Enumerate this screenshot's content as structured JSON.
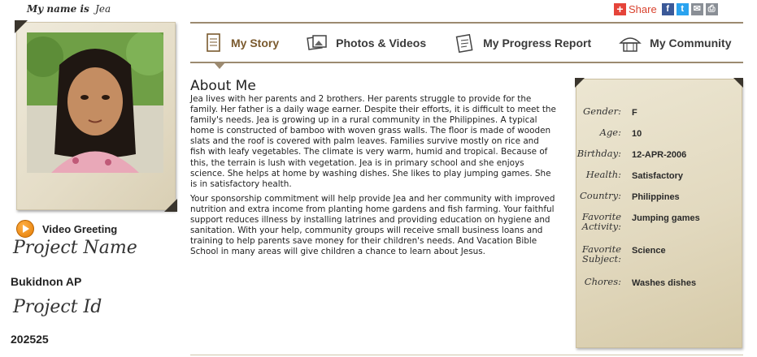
{
  "header": {
    "name_label": "My name is",
    "child_name": "Jea"
  },
  "share": {
    "label": "Share",
    "plus": "+",
    "icons": [
      "facebook-icon",
      "twitter-icon",
      "email-icon",
      "print-icon"
    ]
  },
  "nav": {
    "tabs": [
      {
        "label": "My Story",
        "icon": "book-icon",
        "active": true
      },
      {
        "label": "Photos & Videos",
        "icon": "photos-icon",
        "active": false
      },
      {
        "label": "My Progress Report",
        "icon": "report-icon",
        "active": false
      },
      {
        "label": "My Community",
        "icon": "hut-icon",
        "active": false
      }
    ]
  },
  "video": {
    "label": "Video Greeting"
  },
  "project": {
    "name_label": "Project Name",
    "name_value": "Bukidnon AP",
    "id_label": "Project Id",
    "id_value": "202525"
  },
  "about": {
    "title": "About Me",
    "paragraphs": [
      "Jea lives with her parents and 2 brothers. Her parents struggle to provide for the family. Her father is a daily wage earner. Despite their efforts, it is difficult to meet the family's needs. Jea is growing up in a rural community in the Philippines. A typical home is constructed of bamboo with woven grass walls. The floor is made of wooden slats and the roof is covered with palm leaves. Families survive mostly on rice and fish with leafy vegetables. The climate is very warm, humid and tropical. Because of this, the terrain is lush with vegetation. Jea is in primary school and she enjoys science. She helps at home by washing dishes. She likes to play jumping games. She is in satisfactory health.",
      "Your sponsorship commitment will help provide Jea and her community with improved nutrition and extra income from planting home gardens and fish farming. Your faithful support reduces illness by installing latrines and providing education on hygiene and sanitation. With your help, community groups will receive small business loans and training to help parents save money for their children's needs. And Vacation Bible School in many areas will give children a chance to learn about Jesus."
    ]
  },
  "details": [
    {
      "label": "Gender:",
      "value": "F"
    },
    {
      "label": "Age:",
      "value": "10"
    },
    {
      "label": "Birthday:",
      "value": "12-APR-2006"
    },
    {
      "label": "Health:",
      "value": "Satisfactory"
    },
    {
      "label": "Country:",
      "value": "Philippines"
    },
    {
      "label": "Favorite Activity:",
      "value": "Jumping games"
    },
    {
      "label": "Favorite Subject:",
      "value": "Science"
    },
    {
      "label": "Chores:",
      "value": "Washes dishes"
    }
  ],
  "colors": {
    "accent": "#7a5a2e",
    "rule": "#9c8a70",
    "card": "#e2d9bf",
    "share_red": "#d9432f"
  }
}
